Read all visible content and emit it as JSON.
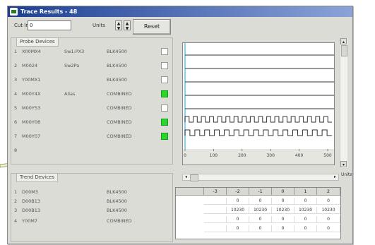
{
  "window": {
    "title": "Trace Results - 48"
  },
  "toolbar": {
    "cutoff_label": "Cut Ini",
    "cutoff_value": "0",
    "units_label": "Units",
    "reset_label": "Reset"
  },
  "probe_section": {
    "title": "Probe Devices",
    "rows": [
      {
        "index": "1",
        "name": "X00MX4",
        "alias": "Sw1:PX3",
        "type": "BLK4500",
        "checked": false
      },
      {
        "index": "2",
        "name": "M0024",
        "alias": "Sw2Pa",
        "type": "BLK4500",
        "checked": false
      },
      {
        "index": "3",
        "name": "Y00MX1",
        "alias": "",
        "type": "BLK4500",
        "checked": false
      },
      {
        "index": "4",
        "name": "M00Y4X",
        "alias": "Alias",
        "type": "COMBINED",
        "checked": true
      },
      {
        "index": "5",
        "name": "M00Y53",
        "alias": "",
        "type": "COMBINED",
        "checked": false
      },
      {
        "index": "6",
        "name": "M00Y08",
        "alias": "",
        "type": "COMBINED",
        "checked": true
      },
      {
        "index": "7",
        "name": "M00Y07",
        "alias": "",
        "type": "COMBINED",
        "checked": true
      },
      {
        "index": "8",
        "name": "",
        "alias": "",
        "type": "",
        "checked": false
      }
    ]
  },
  "timing": {
    "axis_ticks": [
      "0",
      "100",
      "200",
      "300",
      "400",
      "500"
    ],
    "scroll_units": "Units",
    "signals": [
      {
        "kind": "low"
      },
      {
        "kind": "low"
      },
      {
        "kind": "low"
      },
      {
        "kind": "low"
      },
      {
        "kind": "low"
      },
      {
        "kind": "clock",
        "periods": 18
      },
      {
        "kind": "clock",
        "periods": 15
      }
    ]
  },
  "trend_section": {
    "title": "Trend Devices",
    "rows": [
      {
        "index": "1",
        "name": "D00M3",
        "type": "BLK4500"
      },
      {
        "index": "2",
        "name": "D00B13",
        "type": "BLK4500"
      },
      {
        "index": "3",
        "name": "D00B13",
        "type": "BLK4500"
      },
      {
        "index": "4",
        "name": "Y00M7",
        "type": "COMBINED"
      }
    ]
  },
  "value_table": {
    "headers": [
      "-3",
      "-2",
      "-1",
      "0",
      "1",
      "2"
    ],
    "rows": [
      [
        "",
        "0",
        "0",
        "0",
        "0",
        "0"
      ],
      [
        "",
        "10230",
        "10230",
        "10230",
        "10230",
        "10230"
      ],
      [
        "",
        "0",
        "0",
        "0",
        "0",
        "0"
      ],
      [
        "",
        "0",
        "0",
        "0",
        "0",
        "0"
      ]
    ]
  },
  "colors": {
    "check_on": "#2bd62b",
    "title_start": "#1c3f92",
    "cursor": "#55c8f0"
  }
}
